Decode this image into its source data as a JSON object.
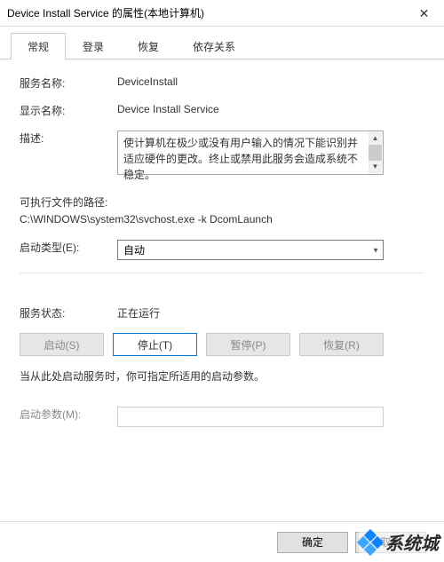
{
  "window": {
    "title": "Device Install Service 的属性(本地计算机)",
    "close": "✕"
  },
  "tabs": {
    "general": "常规",
    "logon": "登录",
    "recovery": "恢复",
    "dependencies": "依存关系"
  },
  "fields": {
    "service_name_label": "服务名称:",
    "service_name_value": "DeviceInstall",
    "display_name_label": "显示名称:",
    "display_name_value": "Device Install Service",
    "description_label": "描述:",
    "description_value": "使计算机在极少或没有用户输入的情况下能识别并适应硬件的更改。终止或禁用此服务会造成系统不稳定。",
    "exe_label": "可执行文件的路径:",
    "exe_value": "C:\\WINDOWS\\system32\\svchost.exe -k DcomLaunch",
    "startup_label": "启动类型(E):",
    "startup_value": "自动",
    "status_label": "服务状态:",
    "status_value": "正在运行",
    "hint": "当从此处启动服务时，你可指定所适用的启动参数。",
    "param_label": "启动参数(M):",
    "param_value": ""
  },
  "buttons": {
    "start": "启动(S)",
    "stop": "停止(T)",
    "pause": "暂停(P)",
    "resume": "恢复(R)",
    "ok": "确定",
    "cancel": "取消"
  },
  "watermark": "系统城"
}
